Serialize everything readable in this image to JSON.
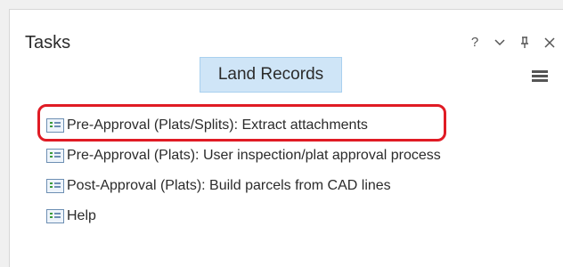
{
  "pane": {
    "title": "Tasks",
    "controls": {
      "help": "?",
      "options": "⌄",
      "pin": "⊥",
      "close": "✕"
    }
  },
  "project": {
    "label": "Land Records"
  },
  "tasks": [
    {
      "label": "Pre-Approval (Plats/Splits): Extract attachments",
      "highlighted": true
    },
    {
      "label": "Pre-Approval (Plats): User inspection/plat approval process"
    },
    {
      "label": "Post-Approval (Plats): Build parcels from CAD lines"
    },
    {
      "label": "Help"
    }
  ],
  "colors": {
    "highlight": "#e01b24",
    "tab_bg": "#cfe5f7",
    "icon_border": "#6d8fb3"
  }
}
